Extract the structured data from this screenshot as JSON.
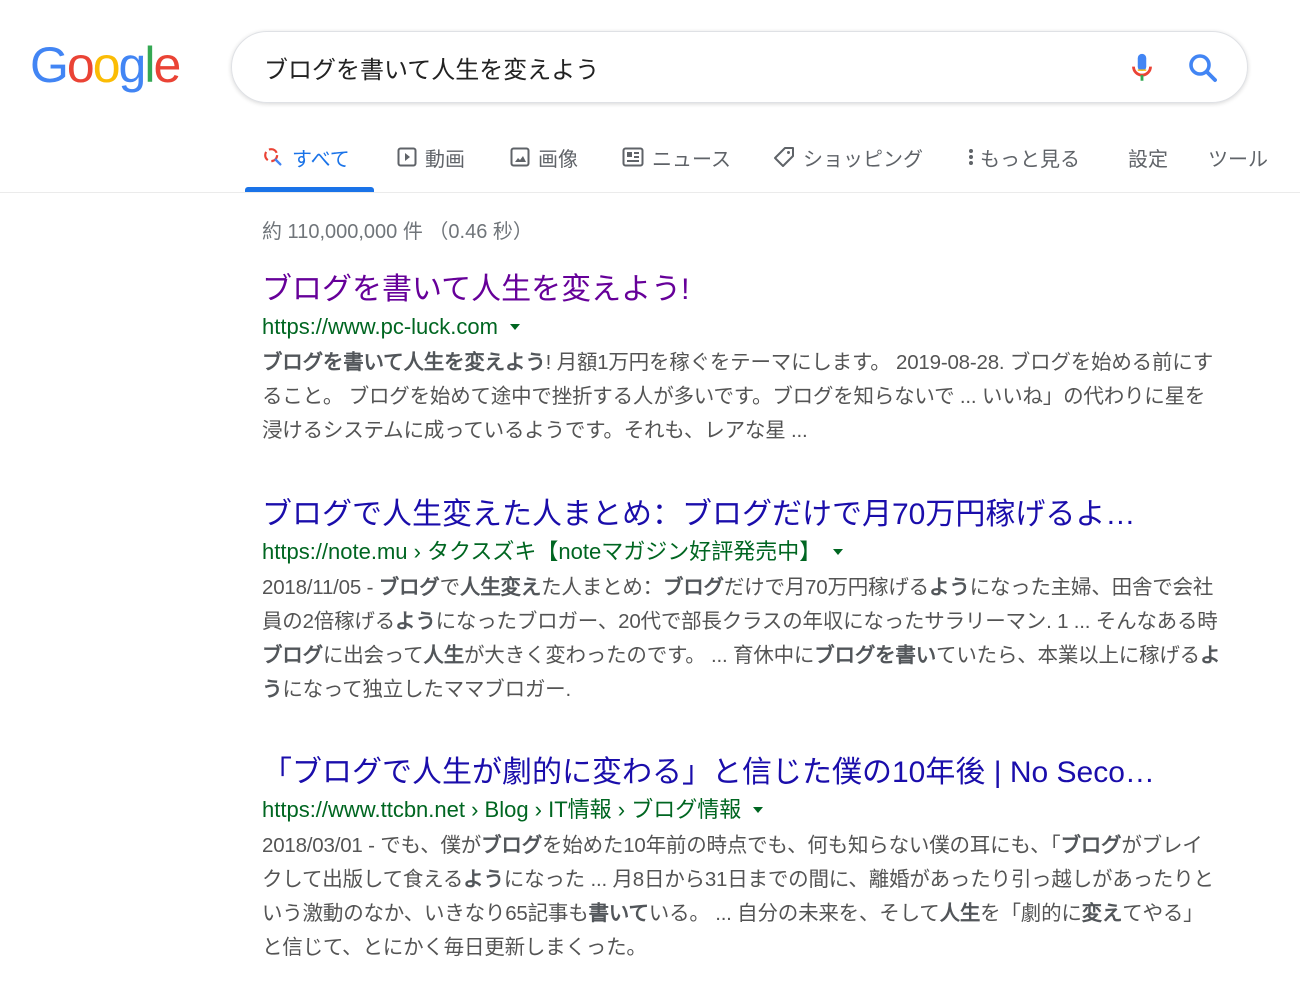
{
  "logo": {
    "text": "Google",
    "colors": [
      "#4285F4",
      "#EA4335",
      "#FBBC05",
      "#4285F4",
      "#34A853",
      "#EA4335"
    ]
  },
  "search": {
    "value": "ブログを書いて人生を変えよう"
  },
  "tabs": [
    {
      "label": "すべて",
      "icon": "search-icon",
      "active": true
    },
    {
      "label": "動画",
      "icon": "video-icon"
    },
    {
      "label": "画像",
      "icon": "image-icon"
    },
    {
      "label": "ニュース",
      "icon": "news-icon"
    },
    {
      "label": "ショッピング",
      "icon": "tag-icon"
    },
    {
      "label": "もっと見る",
      "icon": "more-vert-icon"
    },
    {
      "label": "設定"
    },
    {
      "label": "ツール"
    }
  ],
  "stats": "約 110,000,000 件 （0.46 秒）",
  "results": [
    {
      "title": "ブログを書いて人生を変えよう!",
      "url": "https://www.pc-luck.com",
      "snippet": [
        {
          "t": "ブログを書いて人生を変えよう",
          "b": true
        },
        {
          "t": "! 月額1万円を稼ぐをテーマにします。 2019-08-28. ブログを始める前にすること。 ブログを始めて途中で挫折する人が多いです。ブログを知らないで ... いいね」の代わりに星を浸けるシステムに成っているようです。それも、レアな星 ...",
          "b": false
        }
      ]
    },
    {
      "title": "ブログで人生変えた人まとめ：ブログだけで月70万円稼げるよ…",
      "url": "https://note.mu › タクスズキ【noteマガジン好評発売中】",
      "snippet": [
        {
          "t": "2018/11/05 - ",
          "b": false
        },
        {
          "t": "ブログ",
          "b": true
        },
        {
          "t": "で",
          "b": false
        },
        {
          "t": "人生変え",
          "b": true
        },
        {
          "t": "た人まとめ：",
          "b": false
        },
        {
          "t": "ブログ",
          "b": true
        },
        {
          "t": "だけで月70万円稼げる",
          "b": false
        },
        {
          "t": "よう",
          "b": true
        },
        {
          "t": "になった主婦、田舎で会社員の2倍稼げる",
          "b": false
        },
        {
          "t": "よう",
          "b": true
        },
        {
          "t": "になったブロガー、20代で部長クラスの年収になったサラリーマン. 1 ... そんなある時",
          "b": false
        },
        {
          "t": "ブログ",
          "b": true
        },
        {
          "t": "に出会って",
          "b": false
        },
        {
          "t": "人生",
          "b": true
        },
        {
          "t": "が大きく変わったのです。 ... 育休中に",
          "b": false
        },
        {
          "t": "ブログを書い",
          "b": true
        },
        {
          "t": "ていたら、本業以上に稼げる",
          "b": false
        },
        {
          "t": "よう",
          "b": true
        },
        {
          "t": "になって独立したママブロガー.",
          "b": false
        }
      ]
    },
    {
      "title": "「ブログで人生が劇的に変わる」と信じた僕の10年後 | No Seco…",
      "url": "https://www.ttcbn.net › Blog › IT情報 › ブログ情報",
      "snippet": [
        {
          "t": "2018/03/01 - でも、僕が",
          "b": false
        },
        {
          "t": "ブログ",
          "b": true
        },
        {
          "t": "を始めた10年前の時点でも、何も知らない僕の耳にも、「",
          "b": false
        },
        {
          "t": "ブログ",
          "b": true
        },
        {
          "t": "がブレイクして出版して食える",
          "b": false
        },
        {
          "t": "よう",
          "b": true
        },
        {
          "t": "になった ... 月8日から31日までの間に、離婚があったり引っ越しがあったりという激動のなか、いきなり65記事も",
          "b": false
        },
        {
          "t": "書いて",
          "b": true
        },
        {
          "t": "いる。 ... 自分の未来を、そして",
          "b": false
        },
        {
          "t": "人生",
          "b": true
        },
        {
          "t": "を「劇的に",
          "b": false
        },
        {
          "t": "変え",
          "b": true
        },
        {
          "t": "てやる」と信じて、とにかく毎日更新しまくった。",
          "b": false
        }
      ]
    }
  ]
}
